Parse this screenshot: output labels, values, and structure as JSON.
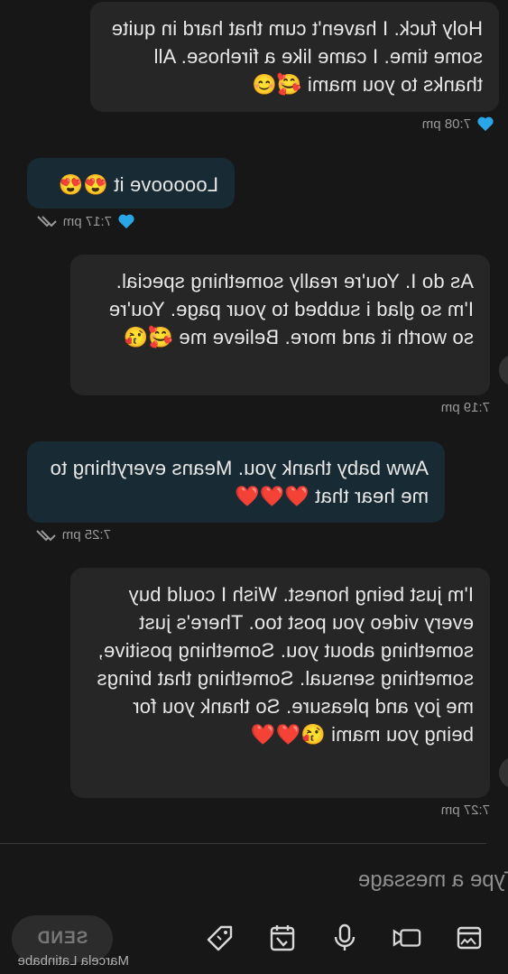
{
  "messages": [
    {
      "text": "Holy fuck. I haven't cum that hard in quite some time. I came like a firehose. All thanks to you mami 🥰😊",
      "time": "7:08 pm",
      "direction": "received",
      "reaction": "blue-heart"
    },
    {
      "text": "Looooove it 😍😍",
      "time": "7:17 pm",
      "direction": "sent",
      "reaction": "blue-heart"
    },
    {
      "text": "As do I. You're really something special. I'm so glad i subbed to your page. You're so worth it and more. Believe me 🥰😘",
      "time": "7:19 pm",
      "direction": "received"
    },
    {
      "text": "Aww baby thank you. Means everything to me hear that ❤️❤️❤️",
      "time": "7:25 pm",
      "direction": "sent"
    },
    {
      "text": "I'm just being honest. Wish I could buy every video you post too. There's just something about you. Something positive, something sensual. Something that brings me joy and pleasure. So thank you for being you mami 😘❤️❤️",
      "time": "7:27 pm",
      "direction": "received"
    }
  ],
  "composer": {
    "placeholder": "Type a message",
    "send_label": "SEND",
    "user_name": "Marcela Latinbabe"
  },
  "colors": {
    "background": "#171717",
    "received_bubble": "#262626",
    "sent_bubble": "#182a33",
    "reaction_heart": "#2aa6e8"
  },
  "toolbar_icons": [
    "media-gallery-icon",
    "video-icon",
    "microphone-icon",
    "schedule-icon",
    "price-tag-icon"
  ]
}
